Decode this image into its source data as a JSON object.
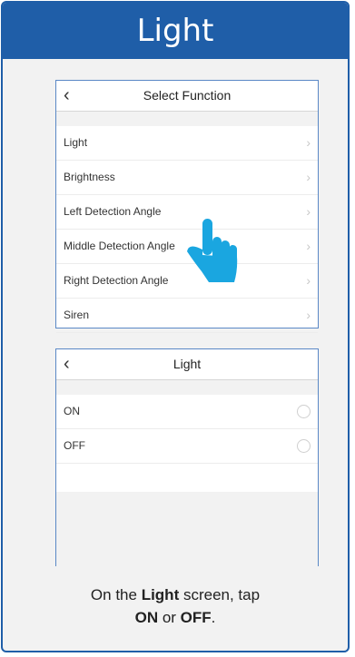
{
  "header": {
    "title": "Light"
  },
  "select_screen": {
    "title": "Select Function",
    "items": [
      {
        "label": "Light"
      },
      {
        "label": "Brightness"
      },
      {
        "label": "Left Detection Angle"
      },
      {
        "label": "Middle Detection Angle"
      },
      {
        "label": "Right Detection Angle"
      },
      {
        "label": "Siren"
      }
    ]
  },
  "light_screen": {
    "title": "Light",
    "options": [
      {
        "label": "ON"
      },
      {
        "label": "OFF"
      }
    ]
  },
  "caption": {
    "part1": "On the ",
    "bold1": "Light",
    "part2": " screen, tap",
    "bold2": "ON",
    "part3": " or ",
    "bold3": "OFF",
    "part4": "."
  },
  "colors": {
    "brand_blue": "#1f5ea8",
    "hand_blue": "#1aa6e0"
  },
  "icons": [
    "back-arrow-icon",
    "chevron-right-icon",
    "radio-button-icon",
    "tap-hand-icon"
  ]
}
